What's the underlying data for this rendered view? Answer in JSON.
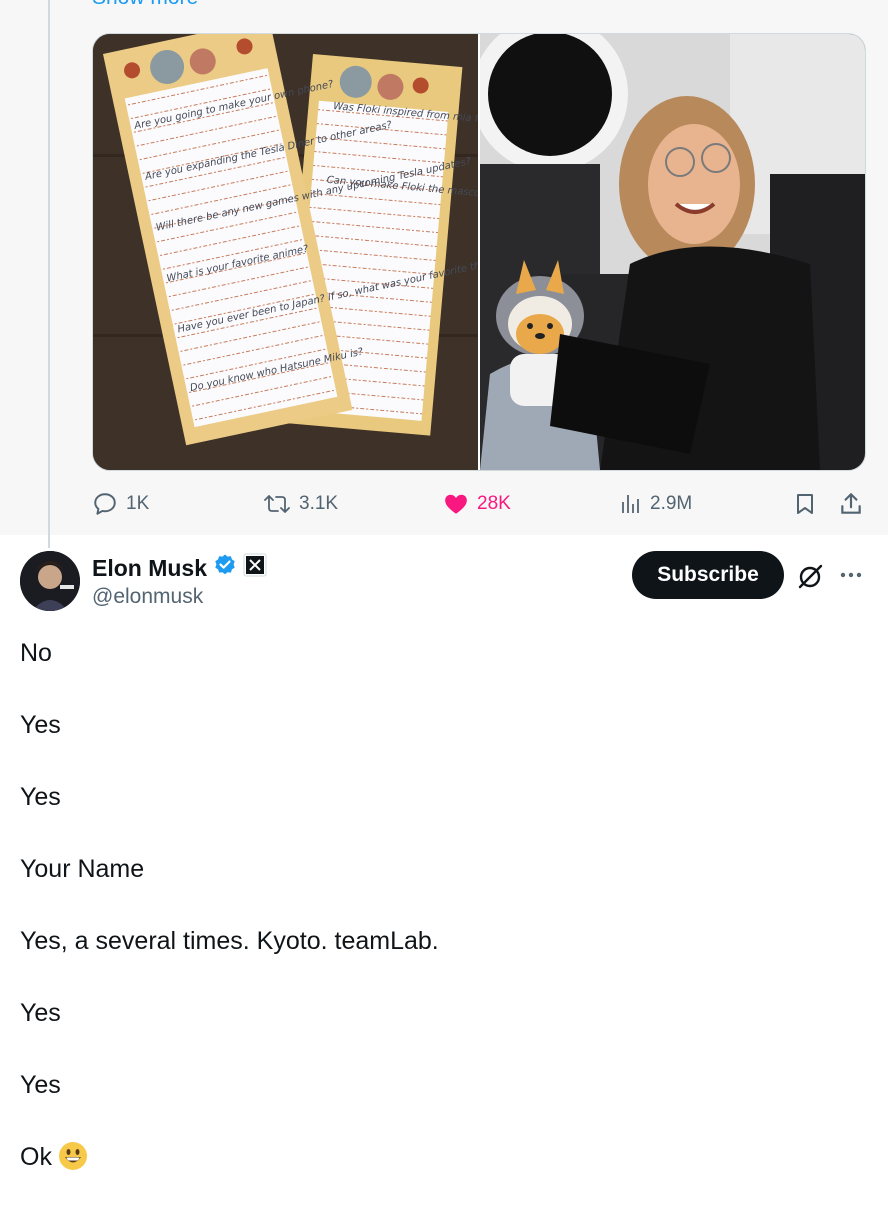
{
  "show_more": "Show more",
  "media": {
    "left_image": "handwritten-letters-photo",
    "right_image": "girl-with-plush-dog-photo",
    "letter1_lines": [
      "Are you going to make your own phone?",
      "Are you expanding the Tesla Diner to other areas?",
      "Will there be any new games with any upcoming Tesla updates?",
      "What is your favorite anime?",
      "Have you ever been to Japan? If so, what was your favorite thing there?",
      "Do you know who Hatsune Miku is?"
    ],
    "letter2_lines": [
      "Was Floki inspired from mia from stawn note",
      "Can you make Floki the mascot for SpaceX?"
    ]
  },
  "actions": {
    "replies": "1K",
    "reposts": "3.1K",
    "likes": "28K",
    "views": "2.9M"
  },
  "reply": {
    "display_name": "Elon Musk",
    "handle": "@elonmusk",
    "subscribe_label": "Subscribe",
    "lines": [
      "No",
      "Yes",
      "Yes",
      "Your Name",
      "Yes, a several times. Kyoto. teamLab.",
      "Yes",
      "Yes",
      "Ok"
    ]
  },
  "colors": {
    "accent": "#1d9bf0",
    "like": "#f91880",
    "secondary_text": "#536471",
    "verified": "#1d9bf0"
  }
}
